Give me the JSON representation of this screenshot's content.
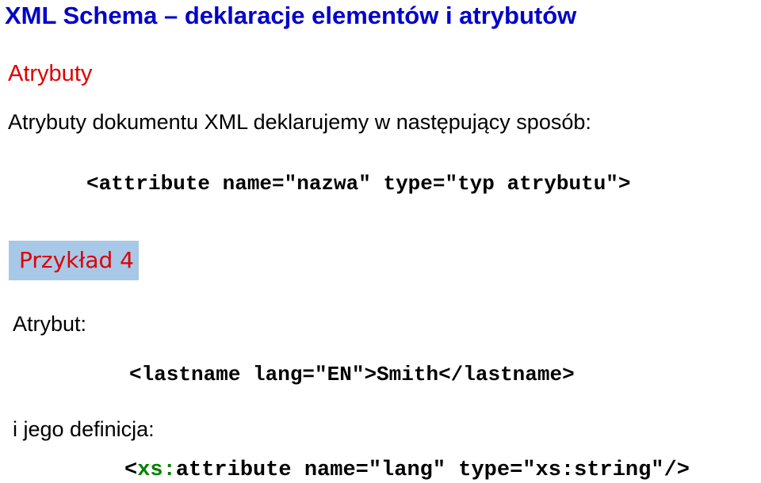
{
  "slide": {
    "title": "XML Schema – deklaracje elementów i atrybutów",
    "section_heading": "Atrybuty",
    "intro_text": "Atrybuty dokumentu XML deklarujemy w następujący sposób:",
    "syntax_code": "<attribute name=\"nazwa\" type=\"typ atrybutu\">",
    "example_badge": "Przykład 4",
    "attribute_label": "Atrybut:",
    "attribute_code": "<lastname lang=\"EN\">Smith</lastname>",
    "definition_label": "i jego definicja:",
    "definition_code": {
      "open": "<",
      "prefix": "xs:",
      "rest": "attribute name=\"lang\" type=\"xs:string\"/>"
    }
  },
  "colors": {
    "title": "#0000cc",
    "heading": "#dd0000",
    "badge_background": "#a8c8e8",
    "namespace_prefix": "#008000"
  }
}
